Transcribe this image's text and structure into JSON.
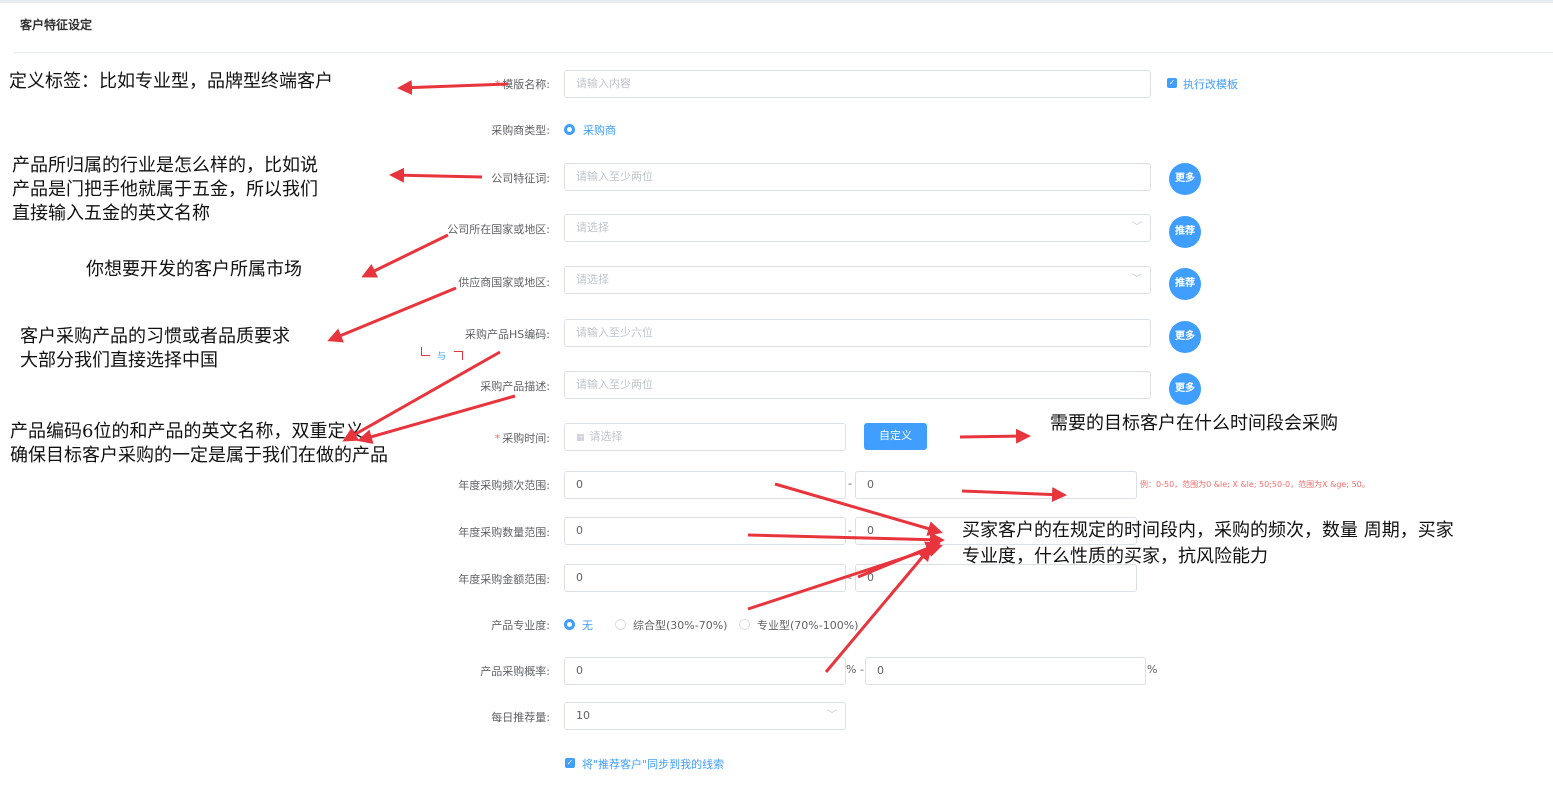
{
  "page": {
    "title": "客户特征设定"
  },
  "form": {
    "template_name": {
      "label": "模版名称:",
      "required": "*",
      "placeholder": "请输入内容"
    },
    "execute_template": {
      "label": "执行改模板"
    },
    "buyer_type": {
      "label": "采购商类型:",
      "option": "采购商"
    },
    "company_keywords": {
      "label": "公司特征词:",
      "placeholder": "请输入至少两位",
      "button": "更多"
    },
    "company_country": {
      "label": "公司所在国家或地区:",
      "placeholder": "请选择",
      "button": "推荐"
    },
    "supplier_country": {
      "label": "供应商国家或地区:",
      "placeholder": "请选择",
      "button": "推荐"
    },
    "hs_code": {
      "label": "采购产品HS编码:",
      "placeholder": "请输入至少六位",
      "button": "更多"
    },
    "and_marker": "与",
    "product_desc": {
      "label": "采购产品描述:",
      "placeholder": "请输入至少两位",
      "button": "更多"
    },
    "purchase_time": {
      "label": "采购时间:",
      "required": "*",
      "placeholder": "请选择",
      "button": "自定义"
    },
    "annual_freq": {
      "label": "年度采购频次范围:",
      "min": "0",
      "max": "0",
      "hint": "例：0-50，范围为0 &le; X &le; 50;50-0，范围为X &ge; 50。"
    },
    "annual_qty": {
      "label": "年度采购数量范围:",
      "min": "0",
      "max": "0"
    },
    "annual_amount": {
      "label": "年度采购金额范围:",
      "min": "0",
      "max": "0"
    },
    "professionalism": {
      "label": "产品专业度:",
      "options": [
        "无",
        "综合型(30%-70%)",
        "专业型(70%-100%)"
      ],
      "selected": "无"
    },
    "purchase_prob": {
      "label": "产品采购概率:",
      "min": "0",
      "max": "0",
      "unit": "%",
      "sep": "% -"
    },
    "daily_recommend": {
      "label": "每日推荐量:",
      "value": "10"
    },
    "sync_leads": {
      "label": "将\"推荐客户\"同步到我的线索"
    },
    "range_sep": "-"
  },
  "annotations": {
    "template": "定义标签：比如专业型，品牌型终端客户",
    "industry": [
      "产品所归属的行业是怎么样的，比如说",
      "产品是门把手他就属于五金，所以我们",
      "直接输入五金的英文名称"
    ],
    "market": "你想要开发的客户所属市场",
    "habits": [
      "客户采购产品的习惯或者品质要求",
      "大部分我们直接选择中国"
    ],
    "hs": [
      "产品编码6位的和产品的英文名称，双重定义，",
      "确保目标客户采购的一定是属于我们在做的产品"
    ],
    "time": "需要的目标客户在什么时间段会采购",
    "buyer": [
      "买家客户的在规定的时间段内，采购的频次，数量 周期，买家",
      "专业度，什么性质的买家，抗风险能力"
    ]
  },
  "colors": {
    "primary": "#409eff",
    "arrow": "#e8343c",
    "danger": "#f56c6c"
  },
  "icons": {
    "calendar": "calendar-icon",
    "chevron": "chevron-down-icon",
    "check": "check-icon"
  }
}
